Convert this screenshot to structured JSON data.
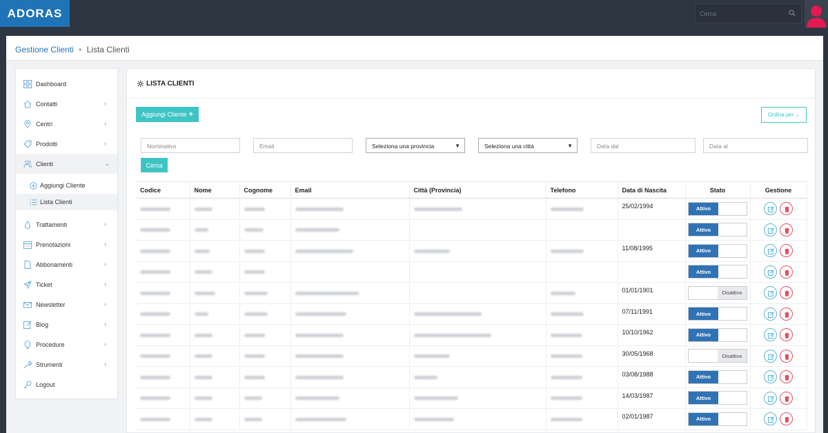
{
  "app": {
    "logo": "ADORAS"
  },
  "topbar": {
    "search_placeholder": "Cerca"
  },
  "breadcrumb": {
    "section": "Gestione Clienti",
    "separator": "•",
    "current": "Lista Clienti"
  },
  "sidebar": {
    "items": [
      {
        "label": "Dashboard",
        "icon": "dashboard-icon"
      },
      {
        "label": "Contatti",
        "icon": "home-icon"
      },
      {
        "label": "Centri",
        "icon": "location-pin-icon"
      },
      {
        "label": "Prodotti",
        "icon": "tag-icon"
      },
      {
        "label": "Clienti",
        "icon": "users-icon"
      },
      {
        "label": "Trattamenti",
        "icon": "drop-icon"
      },
      {
        "label": "Prenotazioni",
        "icon": "calendar-icon"
      },
      {
        "label": "Abbonamenti",
        "icon": "document-icon"
      },
      {
        "label": "Ticket",
        "icon": "paper-plane-icon"
      },
      {
        "label": "Newsletter",
        "icon": "envelope-icon"
      },
      {
        "label": "Blog",
        "icon": "edit-icon"
      },
      {
        "label": "Procedure",
        "icon": "lightbulb-icon"
      },
      {
        "label": "Strumenti",
        "icon": "wrench-icon"
      },
      {
        "label": "Logout",
        "icon": "key-icon"
      }
    ],
    "submenu": [
      {
        "label": "Aggiungi Cliente",
        "icon": "plus-circle-icon"
      },
      {
        "label": "Lista Clienti",
        "icon": "list-icon"
      }
    ]
  },
  "main": {
    "title": "LISTA CLIENTI",
    "add_button": "Aggiungi Cliente",
    "order_button": "Ordina per",
    "filters": {
      "nominativo": "Nominativo",
      "email": "Email",
      "provincia": "Seleziona una provincia",
      "citta": "Seleziona una città",
      "data_dal": "Data dal",
      "data_al": "Data al"
    },
    "search_button": "Cerca"
  },
  "table": {
    "headers": [
      "Codice",
      "Nome",
      "Cognome",
      "Email",
      "Città (Provincia)",
      "Telefono",
      "Data di Nascita",
      "Stato",
      "Gestione"
    ],
    "status_labels": {
      "on": "Attivo",
      "off": "Disattivo"
    },
    "rows": [
      {
        "date": "25/02/1994",
        "active": true
      },
      {
        "date": "",
        "active": true
      },
      {
        "date": "11/08/1995",
        "active": true
      },
      {
        "date": "",
        "active": true
      },
      {
        "date": "01/01/1901",
        "active": false
      },
      {
        "date": "07/11/1991",
        "active": true
      },
      {
        "date": "10/10/1962",
        "active": true
      },
      {
        "date": "30/05/1968",
        "active": false
      },
      {
        "date": "03/08/1988",
        "active": true
      },
      {
        "date": "14/03/1987",
        "active": true
      },
      {
        "date": "02/01/1987",
        "active": true
      }
    ]
  },
  "colors": {
    "brand": "#1f73b7",
    "topbar": "#2e3642",
    "accent": "#3fc4c6",
    "active_toggle": "#2f73b4",
    "delete": "#e0505f"
  }
}
